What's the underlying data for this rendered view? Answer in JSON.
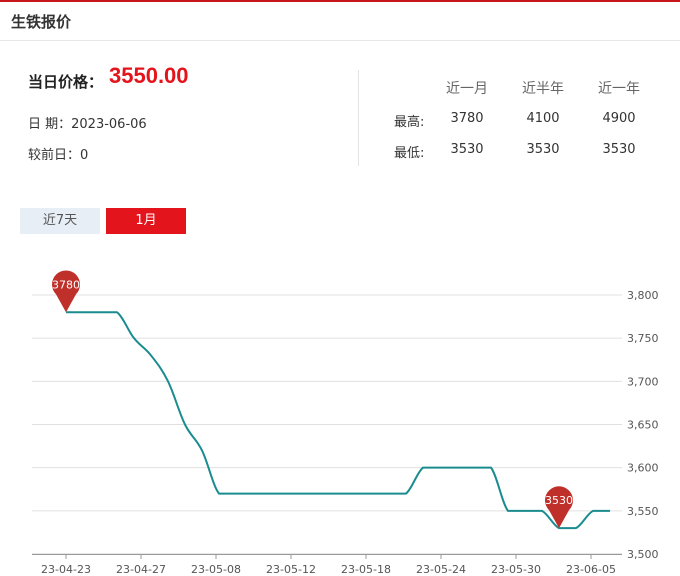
{
  "header": {
    "title": "生铁报价"
  },
  "price": {
    "label": "当日价格：",
    "value": "3550.00",
    "date_label": "日 期：",
    "date": "2023-06-06",
    "change_label": "较前日：",
    "change": "0"
  },
  "stats": {
    "columns": [
      "近一月",
      "近半年",
      "近一年"
    ],
    "rows": [
      {
        "label": "最高:",
        "values": [
          "3780",
          "4100",
          "4900"
        ]
      },
      {
        "label": "最低:",
        "values": [
          "3530",
          "3530",
          "3530"
        ]
      }
    ]
  },
  "tabs": [
    {
      "label": "近7天",
      "active": false
    },
    {
      "label": "1月",
      "active": true
    }
  ],
  "colors": {
    "accent": "#e4141c",
    "line": "#1a8c8f",
    "marker": "#c0302a",
    "tab_inactive": "#e8eef6"
  },
  "chart_data": {
    "type": "line",
    "x_ticks": [
      "23-04-23",
      "23-04-27",
      "23-05-08",
      "23-05-12",
      "23-05-18",
      "23-05-24",
      "23-05-30",
      "23-06-05"
    ],
    "y_ticks": [
      3500,
      3550,
      3600,
      3650,
      3700,
      3750,
      3800
    ],
    "y_tick_labels": [
      "3,500",
      "3,550",
      "3,600",
      "3,650",
      "3,700",
      "3,750",
      "3,800"
    ],
    "ylim": [
      3500,
      3800
    ],
    "grid": true,
    "series": [
      {
        "values": [
          3780,
          3780,
          3780,
          3780,
          3750,
          3730,
          3700,
          3650,
          3620,
          3570,
          3570,
          3570,
          3570,
          3570,
          3570,
          3570,
          3570,
          3570,
          3570,
          3570,
          3570,
          3600,
          3600,
          3600,
          3600,
          3600,
          3550,
          3550,
          3550,
          3530,
          3530,
          3550,
          3550
        ]
      }
    ],
    "markers": [
      {
        "label": "3780",
        "kind": "max",
        "index": 0
      },
      {
        "label": "3530",
        "kind": "min",
        "index": 29
      }
    ]
  }
}
